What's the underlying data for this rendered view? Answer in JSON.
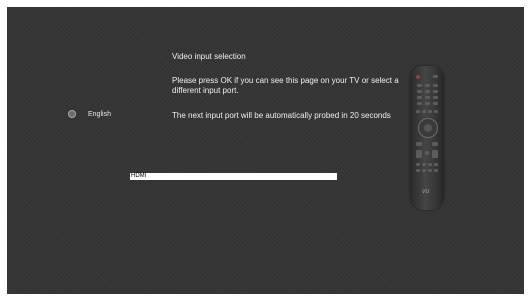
{
  "screen": {
    "title": "Video input selection",
    "message_1": "Please press OK if you can see this page on your TV or select a different input port.",
    "message_2": "The next input port will be automatically probed in 20 seconds",
    "colors": {
      "background": "#353535",
      "text": "#f0f0f0",
      "selected_bar": "#ffffff"
    }
  },
  "language": {
    "label": "English",
    "icon": "radio-button-icon"
  },
  "input": {
    "selected_label": "HDMI"
  },
  "remote": {
    "icon": "remote-control-icon",
    "logo": "vu"
  }
}
